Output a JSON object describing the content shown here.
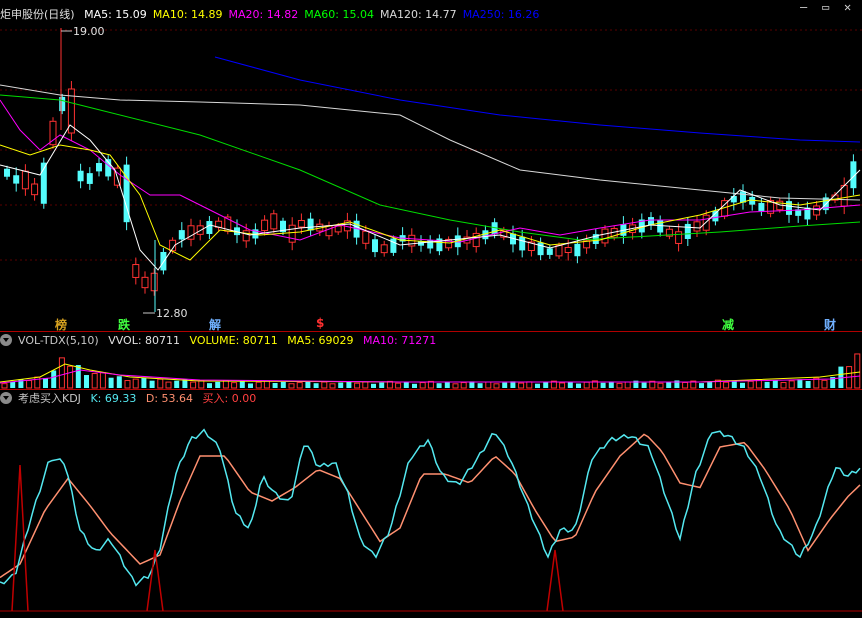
{
  "main": {
    "title": "炬申股份(日线)",
    "ma": [
      {
        "label": "MA5: 15.09",
        "color": "#ffffff"
      },
      {
        "label": "MA10: 14.89",
        "color": "#ffff00"
      },
      {
        "label": "MA20: 14.82",
        "color": "#ff00ff"
      },
      {
        "label": "MA60: 15.04",
        "color": "#00ff00"
      },
      {
        "label": "MA120: 14.77",
        "color": "#d8d8d8"
      },
      {
        "label": "MA250: 16.26",
        "color": "#0000ff"
      }
    ],
    "high_label": "19.00",
    "low_label": "12.80",
    "signals": [
      {
        "text": "榜",
        "color": "#d4a020"
      },
      {
        "text": "跌",
        "color": "#40ff40"
      },
      {
        "text": "解",
        "color": "#70b0ff"
      },
      {
        "text": "$",
        "color": "#ff3030"
      },
      {
        "text": "减",
        "color": "#40ff40"
      },
      {
        "text": "财",
        "color": "#70b0ff"
      }
    ]
  },
  "volume": {
    "name": "VOL-TDX(5,10)",
    "vol": "VVOL: 80711",
    "volume": "VOLUME: 80711",
    "ma5": "MA5: 69029",
    "ma10": "MA10: 71271"
  },
  "kdj": {
    "name": "考虑买入KDJ",
    "k": "K: 69.33",
    "d": "D: 53.64",
    "buy": "买入: 0.00"
  },
  "window": {
    "minimize": "—",
    "restore": "▭",
    "close": "✕"
  },
  "colors": {
    "up": "#ff3232",
    "down": "#54fcfc",
    "k_line": "#54e8f0",
    "d_line": "#ff9070",
    "buy_spike": "#c00000"
  }
}
